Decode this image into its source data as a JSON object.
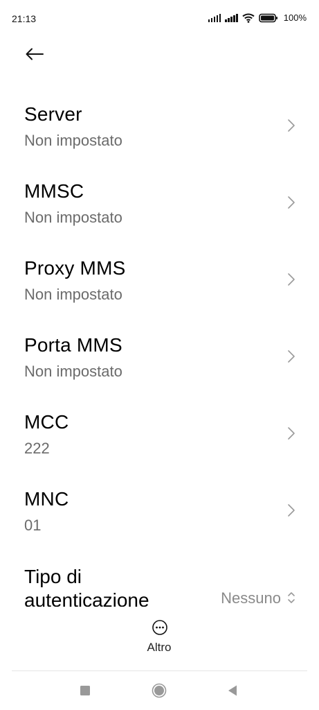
{
  "status_bar": {
    "time": "21:13",
    "battery_percent": "100%",
    "icons": [
      "signal-icon",
      "signal-icon",
      "wifi-icon",
      "battery-icon"
    ]
  },
  "header": {
    "back_icon": "back-arrow-icon"
  },
  "settings": [
    {
      "title": "Server",
      "value": "Non impostato"
    },
    {
      "title": "MMSC",
      "value": "Non impostato"
    },
    {
      "title": "Proxy MMS",
      "value": "Non impostato"
    },
    {
      "title": "Porta MMS",
      "value": "Non impostato"
    },
    {
      "title": "MCC",
      "value": "222"
    },
    {
      "title": "MNC",
      "value": "01"
    }
  ],
  "auth": {
    "title": "Tipo di autenticazione",
    "value": "Nessuno"
  },
  "bottom_action": {
    "label": "Altro",
    "icon": "more-icon"
  },
  "nav_bar": {
    "icons": [
      "recents-icon",
      "home-icon",
      "back-icon"
    ]
  },
  "colors": {
    "text_primary": "#000000",
    "text_secondary": "#6b6b6b",
    "chevron": "#9a9a9a"
  }
}
